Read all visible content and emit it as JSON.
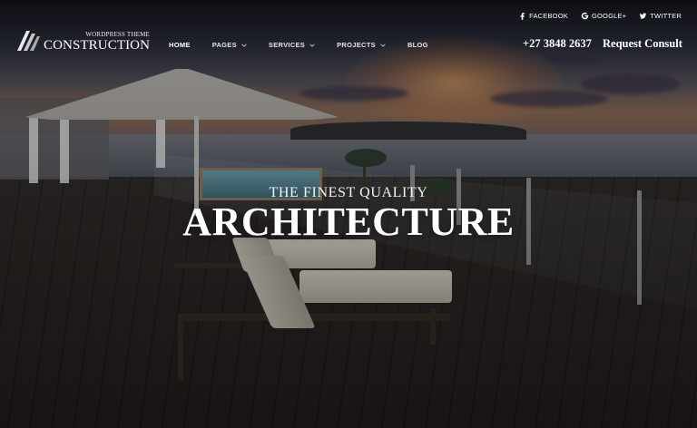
{
  "social": {
    "facebook": {
      "label": "FACEBOOK",
      "icon": "facebook-icon"
    },
    "google": {
      "label": "GOOGLE+",
      "icon": "google-icon"
    },
    "twitter": {
      "label": "TWITTER",
      "icon": "twitter-icon"
    }
  },
  "logo": {
    "sub": "WORDPRESS THEME",
    "main": "CONSTRUCTION"
  },
  "nav": {
    "items": [
      {
        "label": "HOME",
        "active": true,
        "dropdown": false
      },
      {
        "label": "PAGES",
        "active": false,
        "dropdown": true
      },
      {
        "label": "SERVICES",
        "active": false,
        "dropdown": true
      },
      {
        "label": "PROJECTS",
        "active": false,
        "dropdown": true
      },
      {
        "label": "BLOG",
        "active": false,
        "dropdown": false
      }
    ]
  },
  "contact": {
    "phone": "+27 3848 2637",
    "cta": "Request Consult"
  },
  "hero": {
    "subtitle": "THE FINEST QUALITY",
    "title": "ARCHITECTURE"
  },
  "colors": {
    "text": "#ffffff",
    "overlay": "#000000",
    "deck": "#2f2a28"
  }
}
